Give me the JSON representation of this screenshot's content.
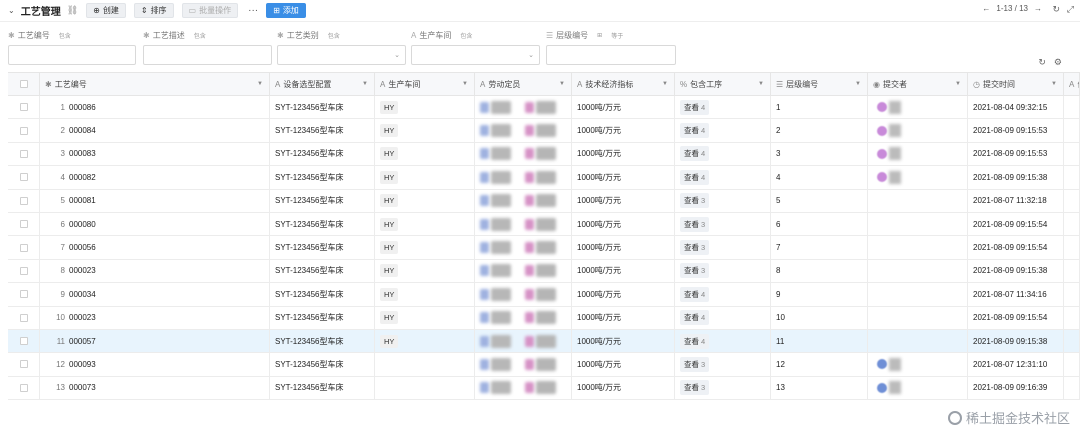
{
  "toolbar": {
    "title": "工艺管理",
    "create_label": "创建",
    "sort_label": "排序",
    "batch_label": "批量操作",
    "more_label": "···",
    "add_label": "添加",
    "page_text": "1-13 / 13"
  },
  "filters": [
    {
      "label": "工艺编号",
      "mode": "包含"
    },
    {
      "label": "工艺描述",
      "mode": "包含"
    },
    {
      "label": "工艺类别",
      "mode": "包含"
    },
    {
      "label": "生产车间",
      "mode": "包含"
    },
    {
      "label": "层级编号",
      "mode": "等于"
    }
  ],
  "columns": [
    {
      "label": "工艺编号",
      "icon": "key-icon"
    },
    {
      "label": "设备选型配置",
      "icon": "text-icon"
    },
    {
      "label": "生产车间",
      "icon": "text-icon"
    },
    {
      "label": "劳动定员",
      "icon": "text-icon"
    },
    {
      "label": "技术经济指标",
      "icon": "text-icon"
    },
    {
      "label": "包含工序",
      "icon": "link-icon"
    },
    {
      "label": "层级编号",
      "icon": "number-icon"
    },
    {
      "label": "提交者",
      "icon": "user-icon"
    },
    {
      "label": "提交时间",
      "icon": "clock-icon"
    },
    {
      "label": "备注",
      "icon": "text-icon"
    }
  ],
  "rows": [
    {
      "n": "1",
      "code": "000086",
      "equip": "SYT-123456型车床",
      "shop": "HY",
      "idx": "1000吨/万元",
      "proc": "查看",
      "pc": "4",
      "level": "1",
      "sub": true,
      "time": "2021-08-04 09:32:15"
    },
    {
      "n": "2",
      "code": "000084",
      "equip": "SYT-123456型车床",
      "shop": "HY",
      "idx": "1000吨/万元",
      "proc": "查看",
      "pc": "4",
      "level": "2",
      "sub": true,
      "time": "2021-08-09 09:15:53"
    },
    {
      "n": "3",
      "code": "000083",
      "equip": "SYT-123456型车床",
      "shop": "HY",
      "idx": "1000吨/万元",
      "proc": "查看",
      "pc": "4",
      "level": "3",
      "sub": true,
      "time": "2021-08-09 09:15:53"
    },
    {
      "n": "4",
      "code": "000082",
      "equip": "SYT-123456型车床",
      "shop": "HY",
      "idx": "1000吨/万元",
      "proc": "查看",
      "pc": "4",
      "level": "4",
      "sub": true,
      "time": "2021-08-09 09:15:38"
    },
    {
      "n": "5",
      "code": "000081",
      "equip": "SYT-123456型车床",
      "shop": "HY",
      "idx": "1000吨/万元",
      "proc": "查看",
      "pc": "3",
      "level": "5",
      "sub": false,
      "time": "2021-08-07 11:32:18"
    },
    {
      "n": "6",
      "code": "000080",
      "equip": "SYT-123456型车床",
      "shop": "HY",
      "idx": "1000吨/万元",
      "proc": "查看",
      "pc": "3",
      "level": "6",
      "sub": false,
      "time": "2021-08-09 09:15:54"
    },
    {
      "n": "7",
      "code": "000056",
      "equip": "SYT-123456型车床",
      "shop": "HY",
      "idx": "1000吨/万元",
      "proc": "查看",
      "pc": "3",
      "level": "7",
      "sub": false,
      "time": "2021-08-09 09:15:54"
    },
    {
      "n": "8",
      "code": "000023",
      "equip": "SYT-123456型车床",
      "shop": "HY",
      "idx": "1000吨/万元",
      "proc": "查看",
      "pc": "3",
      "level": "8",
      "sub": false,
      "time": "2021-08-09 09:15:38"
    },
    {
      "n": "9",
      "code": "000034",
      "equip": "SYT-123456型车床",
      "shop": "HY",
      "idx": "1000吨/万元",
      "proc": "查看",
      "pc": "4",
      "level": "9",
      "sub": false,
      "time": "2021-08-07 11:34:16"
    },
    {
      "n": "10",
      "code": "000023",
      "equip": "SYT-123456型车床",
      "shop": "HY",
      "idx": "1000吨/万元",
      "proc": "查看",
      "pc": "4",
      "level": "10",
      "sub": false,
      "time": "2021-08-09 09:15:54"
    },
    {
      "n": "11",
      "code": "000057",
      "equip": "SYT-123456型车床",
      "shop": "HY",
      "idx": "1000吨/万元",
      "proc": "查看",
      "pc": "4",
      "level": "11",
      "sub": false,
      "time": "2021-08-09 09:15:38"
    },
    {
      "n": "12",
      "code": "000093",
      "equip": "SYT-123456型车床",
      "shop": "",
      "idx": "1000吨/万元",
      "proc": "查看",
      "pc": "3",
      "level": "12",
      "sub": "blue",
      "time": "2021-08-07 12:31:10"
    },
    {
      "n": "13",
      "code": "000073",
      "equip": "SYT-123456型车床",
      "shop": "",
      "idx": "1000吨/万元",
      "proc": "查看",
      "pc": "3",
      "level": "13",
      "sub": "blue",
      "time": "2021-08-09 09:16:39"
    }
  ],
  "selected_row": 10,
  "watermark": "稀土掘金技术社区",
  "colors": {
    "primary": "#3a8ee6",
    "selected_row": "#e8f4fd"
  }
}
